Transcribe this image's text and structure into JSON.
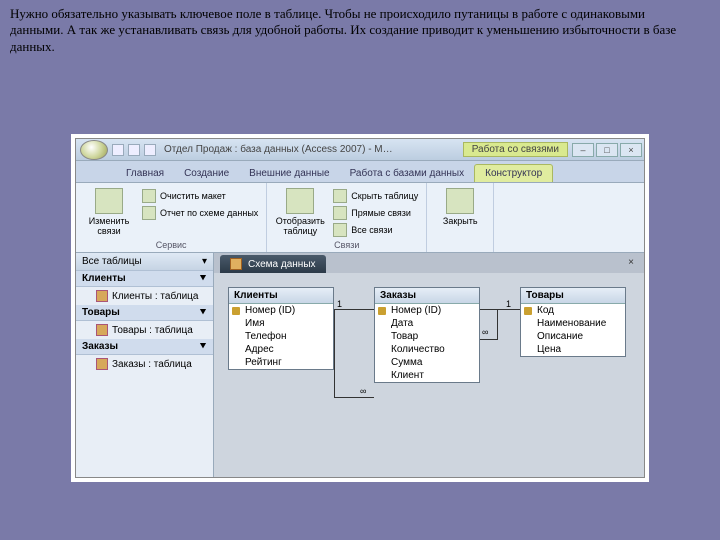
{
  "paragraph": "Нужно обязательно указывать ключевое поле  в таблице. Чтобы не происходило путаницы в работе с  одинаковыми данными. А так же устанавливать связь для удобной работы.  Их создание приводит к уменьшению избыточности в базе данных.",
  "window": {
    "title": "Отдел Продаж : база данных (Access 2007) - M…",
    "context_title": "Работа со связями"
  },
  "tabs": {
    "home": "Главная",
    "create": "Создание",
    "external": "Внешние данные",
    "dbtools": "Работа с базами данных",
    "designer": "Конструктор"
  },
  "ribbon": {
    "group1": {
      "big": "Изменить связи",
      "s1": "Очистить макет",
      "s2": "Отчет по схеме данных",
      "label": "Сервис"
    },
    "group2": {
      "big": "Отобразить таблицу",
      "s1": "Скрыть таблицу",
      "s2": "Прямые связи",
      "s3": "Все связи",
      "label": "Связи"
    },
    "group3": {
      "big": "Закрыть"
    }
  },
  "nav": {
    "header": "Все таблицы",
    "g1": {
      "title": "Клиенты",
      "item": "Клиенты : таблица"
    },
    "g2": {
      "title": "Товары",
      "item": "Товары : таблица"
    },
    "g3": {
      "title": "Заказы",
      "item": "Заказы : таблица"
    }
  },
  "doc_tab": "Схема данных",
  "tables": {
    "clients": {
      "title": "Клиенты",
      "f1": "Номер (ID)",
      "f2": "Имя",
      "f3": "Телефон",
      "f4": "Адрес",
      "f5": "Рейтинг"
    },
    "orders": {
      "title": "Заказы",
      "f1": "Номер (ID)",
      "f2": "Дата",
      "f3": "Товар",
      "f4": "Количество",
      "f5": "Сумма",
      "f6": "Клиент"
    },
    "goods": {
      "title": "Товары",
      "f1": "Код",
      "f2": "Наименование",
      "f3": "Описание",
      "f4": "Цена"
    }
  },
  "rel": {
    "one": "1",
    "many": "∞"
  }
}
